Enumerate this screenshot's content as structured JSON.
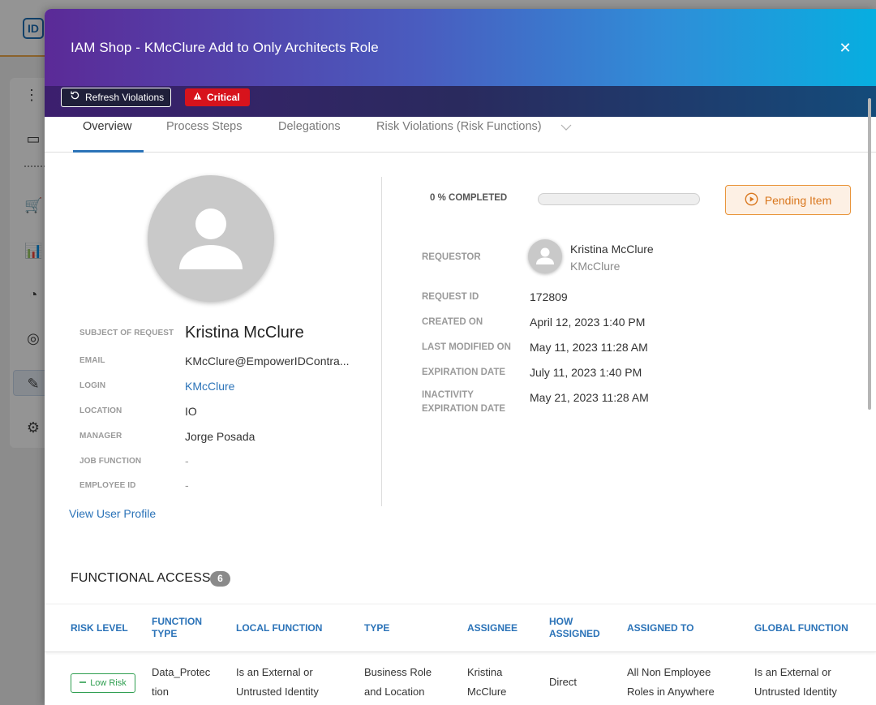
{
  "background": {
    "logo_text": "ID"
  },
  "modal": {
    "title": "IAM Shop - KMcClure Add to Only Architects Role",
    "refresh_label": "Refresh Violations",
    "critical_label": "Critical"
  },
  "tabs": [
    {
      "label": "Overview"
    },
    {
      "label": "Process Steps"
    },
    {
      "label": "Delegations"
    },
    {
      "label": "Risk Violations (Risk Functions)"
    }
  ],
  "subject": {
    "subject_label": "SUBJECT OF REQUEST",
    "name": "Kristina McClure",
    "email_label": "EMAIL",
    "email": "KMcClure@EmpowerIDContra...",
    "login_label": "LOGIN",
    "login": "KMcClure",
    "location_label": "LOCATION",
    "location": "IO",
    "manager_label": "MANAGER",
    "manager": "Jorge Posada",
    "job_function_label": "JOB FUNCTION",
    "job_function": "-",
    "employee_id_label": "EMPLOYEE ID",
    "employee_id": "-",
    "view_profile": "View User Profile"
  },
  "request": {
    "progress_label": "0 % COMPLETED",
    "progress_fraction": 0,
    "status": "Pending Item",
    "requestor_label": "REQUESTOR",
    "requestor_name": "Kristina McClure",
    "requestor_login": "KMcClure",
    "request_id_label": "REQUEST ID",
    "request_id": "172809",
    "created_label": "CREATED ON",
    "created": "April 12, 2023 1:40 PM",
    "modified_label": "LAST MODIFIED ON",
    "modified": "May 11, 2023 11:28 AM",
    "expiration_label": "EXPIRATION DATE",
    "expiration": "July 11, 2023 1:40 PM",
    "inactivity_label_1": "INACTIVITY",
    "inactivity_label_2": "EXPIRATION DATE",
    "inactivity": "May 21, 2023 11:28 AM"
  },
  "functional_access": {
    "title": "FUNCTIONAL ACCESS",
    "count": "6",
    "headers": {
      "risk_level": "RISK LEVEL",
      "function_type_1": "FUNCTION",
      "function_type_2": "TYPE",
      "local_function": "LOCAL FUNCTION",
      "type": "TYPE",
      "assignee": "ASSIGNEE",
      "how_assigned_1": "HOW",
      "how_assigned_2": "ASSIGNED",
      "assigned_to": "ASSIGNED TO",
      "global_function": "GLOBAL FUNCTION"
    },
    "rows": [
      {
        "risk_level": "Low Risk",
        "function_type_1": "Data_Protec",
        "function_type_2": "tion",
        "local_function_1": "Is an External or",
        "local_function_2": "Untrusted Identity",
        "type_1": "Business Role",
        "type_2": "and Location",
        "assignee_1": "Kristina",
        "assignee_2": "McClure",
        "how_assigned": "Direct",
        "assigned_to_1": "All Non Employee",
        "assigned_to_2": "Roles in Anywhere",
        "global_function_1": "Is an External or",
        "global_function_2": "Untrusted Identity"
      }
    ]
  },
  "colors": {
    "accent": "#2b73b8",
    "critical": "#d7131c",
    "pending": "#e9953b",
    "low_risk": "#2e9e4f"
  }
}
